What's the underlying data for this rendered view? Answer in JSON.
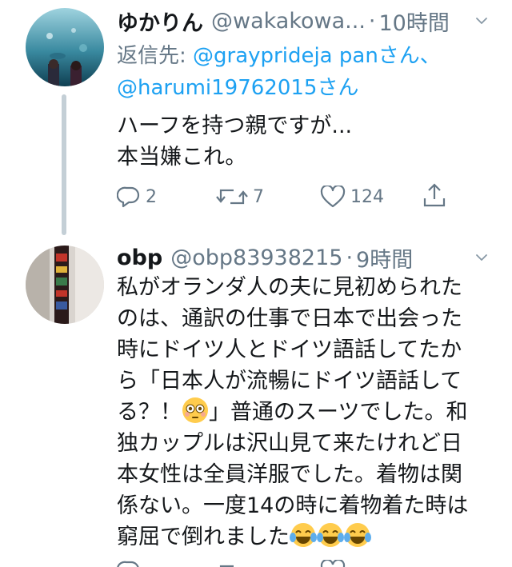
{
  "tweets": [
    {
      "name": "ゆかりん",
      "handle": "@wakakowa...",
      "dot": "·",
      "time": "10時間",
      "reply_label": "返信先:",
      "reply_mention_1": "@grayprideja pan",
      "reply_mention_1_full": "@grayprideja panさん、",
      "reply_mention_2": "@harumi19762015さん",
      "body_lines": [
        "ハーフを持つ親ですが...",
        "本当嫌これ。"
      ],
      "counts": {
        "replies": "2",
        "retweets": "7",
        "likes": "124"
      }
    },
    {
      "name": "obp",
      "handle": "@obp83938215",
      "dot": "·",
      "time": "9時間",
      "body_lines": [
        "私がオランダ人の夫に見初められた",
        "のは、通訳の仕事で日本で出会った",
        "時にドイツ人とドイツ語話してたか",
        "ら「日本人が流暢にドイツ語話して",
        "る？！",
        "」普通のスーツでした。和",
        "独カップルは沢山見て来たけれど日",
        "本女性は全員洋服でした。着物は関",
        "係ない。一度14の時に着物着た時は",
        "窮屈で倒れました"
      ]
    }
  ],
  "icons": {
    "reply": "reply-icon",
    "retweet": "retweet-icon",
    "like": "heart-icon",
    "share": "share-icon",
    "more": "chevron-down-icon",
    "flushed": "flushed-face-emoji",
    "laugh": "tears-of-joy-emoji"
  },
  "colors": {
    "text": "#14171a",
    "muted": "#657786",
    "link": "#1da1f2",
    "thread": "#c4cfd6"
  }
}
